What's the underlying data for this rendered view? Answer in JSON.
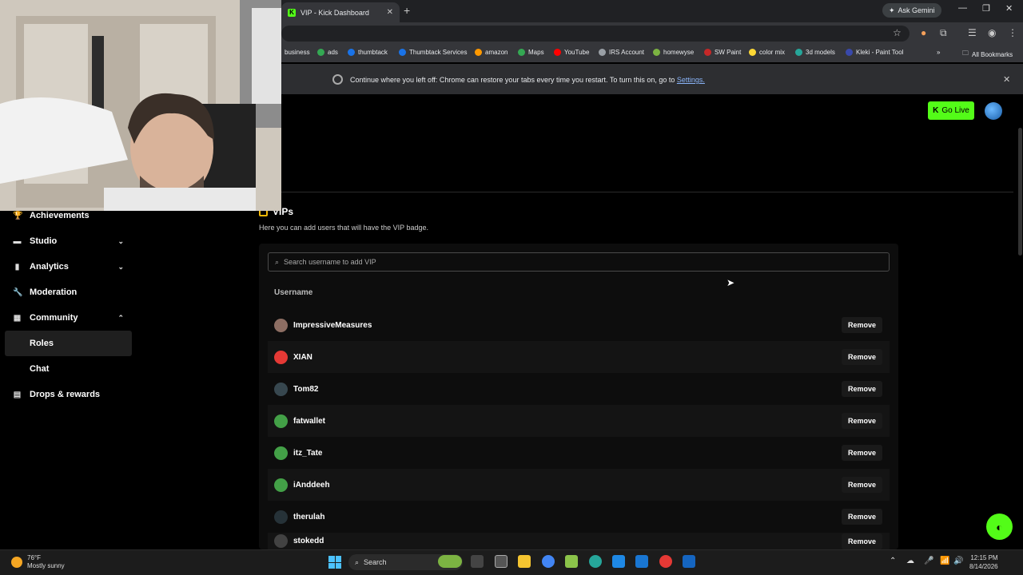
{
  "browser": {
    "tab_title": "VIP - Kick Dashboard",
    "tab_favicon": "K",
    "new_tab_icon": "+",
    "gemini_label": "Ask Gemini",
    "bookmarks": [
      {
        "label": "business",
        "color": "#5f6368"
      },
      {
        "label": "ads",
        "color": "#34a853"
      },
      {
        "label": "thumbtack",
        "color": "#1a73e8"
      },
      {
        "label": "Thumbtack Services",
        "color": "#1a73e8"
      },
      {
        "label": "amazon",
        "color": "#ff9900"
      },
      {
        "label": "Maps",
        "color": "#34a853"
      },
      {
        "label": "YouTube",
        "color": "#ff0000"
      },
      {
        "label": "IRS Account",
        "color": "#9aa0a6"
      },
      {
        "label": "homewyse",
        "color": "#7cb342"
      },
      {
        "label": "SW Paint",
        "color": "#c62828"
      },
      {
        "label": "color mix",
        "color": "#fdd835"
      },
      {
        "label": "3d models",
        "color": "#26a69a"
      },
      {
        "label": "Kleki - Paint Tool",
        "color": "#3949ab"
      }
    ],
    "all_bookmarks": "All Bookmarks",
    "more_bookmarks": "»",
    "info_text": "Continue where you left off: Chrome can restore your tabs every time you restart. To turn this on, go to",
    "info_link": "Settings.",
    "info_close": "✕"
  },
  "header": {
    "go_live": "Go Live",
    "go_live_icon": "K"
  },
  "sidebar": {
    "items": [
      {
        "label": "Achievements",
        "icon": "trophy-icon",
        "glyph": "🏆"
      },
      {
        "label": "Studio",
        "icon": "studio-icon",
        "glyph": "▬",
        "chevron": "⌄"
      },
      {
        "label": "Analytics",
        "icon": "analytics-icon",
        "glyph": "▮",
        "chevron": "⌄"
      },
      {
        "label": "Moderation",
        "icon": "wrench-icon",
        "glyph": "🔧"
      },
      {
        "label": "Community",
        "icon": "community-icon",
        "glyph": "▦",
        "chevron": "⌃"
      }
    ],
    "sub_items": [
      {
        "label": "Roles",
        "active": true
      },
      {
        "label": "Chat",
        "active": false
      }
    ],
    "drops": {
      "label": "Drops & rewards",
      "icon": "gift-icon",
      "glyph": "▤"
    }
  },
  "main": {
    "title": "VIPs",
    "subtitle": "Here you can add users that will have the VIP badge.",
    "search_placeholder": "Search username to add VIP",
    "column_header": "Username",
    "remove_label": "Remove",
    "users": [
      {
        "name": "ImpressiveMeasures",
        "avatar_color": "#8d6e63"
      },
      {
        "name": "XIAN",
        "avatar_color": "#e53935"
      },
      {
        "name": "Tom82",
        "avatar_color": "#37474f"
      },
      {
        "name": "fatwallet",
        "avatar_color": "#43a047"
      },
      {
        "name": "itz_Tate",
        "avatar_color": "#43a047"
      },
      {
        "name": "iAnddeeh",
        "avatar_color": "#43a047"
      },
      {
        "name": "therulah",
        "avatar_color": "#263238"
      },
      {
        "name": "stokedd",
        "avatar_color": "#424242"
      }
    ]
  },
  "taskbar": {
    "temp": "76°F",
    "weather": "Mostly sunny",
    "search": "Search",
    "time": "12:15 PM",
    "date": "8/14/2026"
  }
}
